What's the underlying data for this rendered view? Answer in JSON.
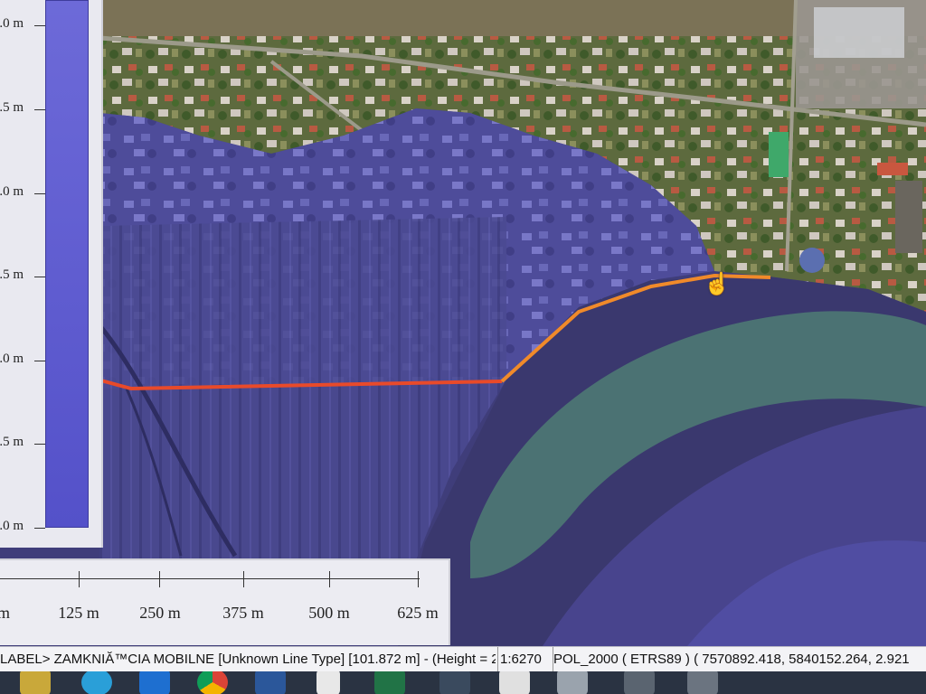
{
  "legend": {
    "ticks": [
      ".0 m",
      ".5 m",
      ".0 m",
      ".5 m",
      ".0 m",
      ".5 m",
      ".0 m"
    ],
    "fill_color": "#5e5bd0"
  },
  "scale": {
    "labels": [
      "m",
      "125 m",
      "250 m",
      "375 m",
      "500 m",
      "625 m"
    ]
  },
  "status": {
    "feature": "LABEL> ZAMKNIĂ™CIA MOBILNE [Unknown Line Type] [101.872 m] - (Height = 2.9",
    "map_scale": "1:6270",
    "projection": "POL_2000 ( ETRS89 ) ( 7570892.418, 5840152.264, 2.921"
  },
  "profile_line": {
    "colors": [
      "#e84a2a",
      "#f08a2a"
    ]
  },
  "taskbar": {
    "apps": [
      "file-explorer-icon",
      "telegram-icon",
      "teamviewer-icon",
      "chrome-icon",
      "word-icon",
      "document-icon",
      "excel-icon",
      "app-icon",
      "app-icon",
      "app-icon",
      "app-icon",
      "app-icon"
    ]
  },
  "cursor": "hand-cursor-icon"
}
